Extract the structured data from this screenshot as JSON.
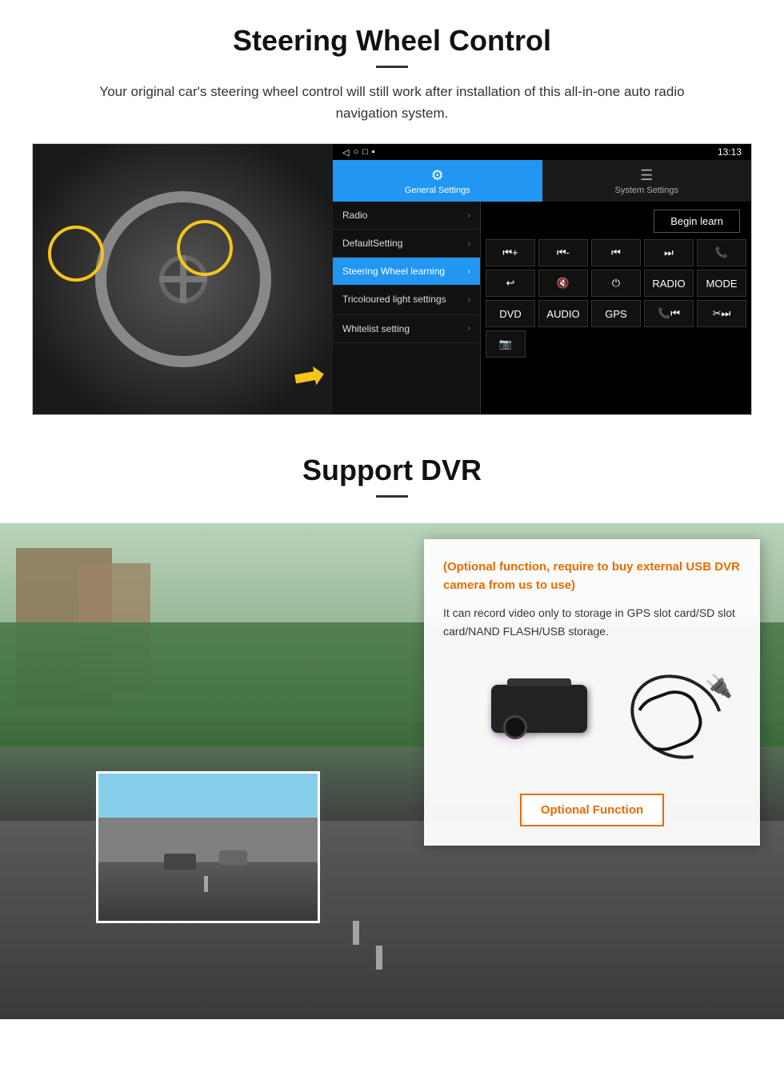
{
  "steering": {
    "title": "Steering Wheel Control",
    "description": "Your original car's steering wheel control will still work after installation of this all-in-one auto radio navigation system.",
    "statusbar": {
      "time": "13:13",
      "icons": "▾ ▾ ▾"
    },
    "tabs": {
      "general": "General Settings",
      "system": "System Settings"
    },
    "menu": {
      "items": [
        {
          "label": "Radio",
          "active": false
        },
        {
          "label": "DefaultSetting",
          "active": false
        },
        {
          "label": "Steering Wheel learning",
          "active": true
        },
        {
          "label": "Tricoloured light settings",
          "active": false
        },
        {
          "label": "Whitelist setting",
          "active": false
        }
      ]
    },
    "controls": {
      "begin_learn": "Begin learn",
      "row1": [
        "⏮+",
        "⏮-",
        "⏮⏮",
        "⏭⏭",
        "📞"
      ],
      "row2": [
        "↩",
        "🔇",
        "⏻",
        "RADIO",
        "MODE"
      ],
      "row3": [
        "DVD",
        "AUDIO",
        "GPS",
        "📞⏮",
        "✂⏭"
      ],
      "row4_icon": "📷"
    }
  },
  "dvr": {
    "title": "Support DVR",
    "optional_warning": "(Optional function, require to buy external USB DVR camera from us to use)",
    "description": "It can record video only to storage in GPS slot card/SD slot card/NAND FLASH/USB storage.",
    "optional_button": "Optional Function"
  }
}
